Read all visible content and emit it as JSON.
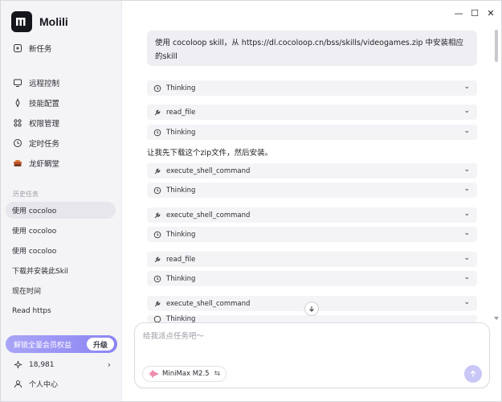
{
  "app": {
    "name": "Molili"
  },
  "sidebar": {
    "new_task": "新任务",
    "items": [
      {
        "label": "远程控制",
        "icon": "monitor-icon"
      },
      {
        "label": "技能配置",
        "icon": "skill-icon"
      },
      {
        "label": "权限管理",
        "icon": "grid-icon"
      },
      {
        "label": "定时任务",
        "icon": "clock-icon"
      },
      {
        "label": "龙虾鲷堂",
        "icon": "lobster-icon"
      }
    ],
    "history_label": "历史任务",
    "history": [
      "使用 cocoloo",
      "使用 cocoloo",
      "使用 cocoloo",
      "下载并安装此Skil",
      "现在时间",
      "Read https"
    ],
    "upgrade": {
      "text": "解锁全量会员权益",
      "button": "升级"
    },
    "credits": "18,981",
    "user_center": "个人中心"
  },
  "window": {
    "minimize": "—",
    "maximize": "☐",
    "close": "✕"
  },
  "chat": {
    "user_message": "使用 cocoloop skill，从 https://dl.cocoloop.cn/bss/skills/videogames.zip 中安装相应的skill",
    "steps": [
      {
        "label": "Thinking",
        "type": "thinking"
      },
      {
        "label": "read_file",
        "type": "tool"
      },
      {
        "label": "Thinking",
        "type": "thinking"
      },
      {
        "label": "execute_shell_command",
        "type": "tool"
      },
      {
        "label": "Thinking",
        "type": "thinking"
      },
      {
        "label": "execute_shell_command",
        "type": "tool"
      },
      {
        "label": "Thinking",
        "type": "thinking"
      },
      {
        "label": "read_file",
        "type": "tool"
      },
      {
        "label": "Thinking",
        "type": "thinking"
      },
      {
        "label": "execute_shell_command",
        "type": "tool"
      },
      {
        "label": "Thinking",
        "type": "thinking"
      }
    ],
    "assistant_text": "让我先下载这个zip文件，然后安装。"
  },
  "input": {
    "placeholder": "给我派点任务吧～",
    "model": "MiniMax M2.5",
    "swap_symbol": "⇆"
  },
  "colors": {
    "accent": "#8b85f2",
    "send": "#c9c7f5"
  }
}
